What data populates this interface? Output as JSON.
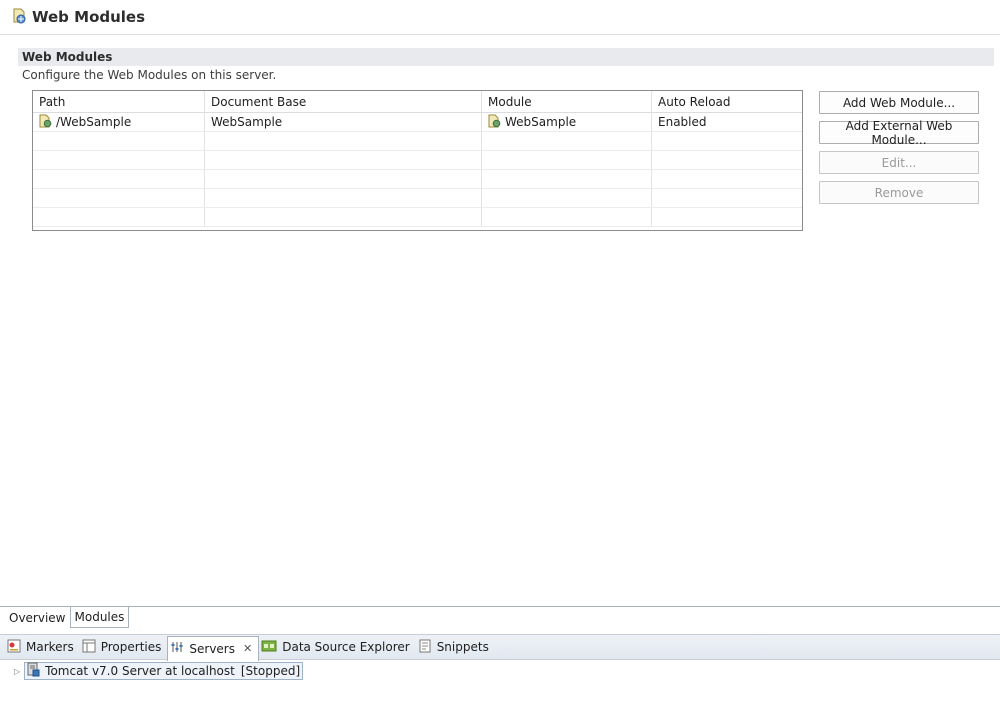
{
  "header": {
    "title": "Web Modules",
    "icon": "server-module-icon"
  },
  "section": {
    "title": "Web Modules",
    "description": "Configure the Web Modules on this server."
  },
  "table": {
    "columns": [
      "Path",
      "Document Base",
      "Module",
      "Auto Reload"
    ],
    "rows": [
      {
        "path": "/WebSample",
        "document_base": "WebSample",
        "module": "WebSample",
        "auto_reload": "Enabled"
      }
    ]
  },
  "buttons": {
    "add": "Add Web Module...",
    "add_external": "Add External Web Module...",
    "edit": "Edit...",
    "remove": "Remove"
  },
  "editor_tabs": [
    "Overview",
    "Modules"
  ],
  "view_tabs": [
    "Markers",
    "Properties",
    "Servers",
    "Data Source Explorer",
    "Snippets"
  ],
  "servers": {
    "item": "Tomcat v7.0 Server at localhost",
    "state": "[Stopped]"
  },
  "colors": {
    "accent": "#3c74b8",
    "section_bg": "#e8eaed",
    "view_bar": "#e1e8f0"
  }
}
